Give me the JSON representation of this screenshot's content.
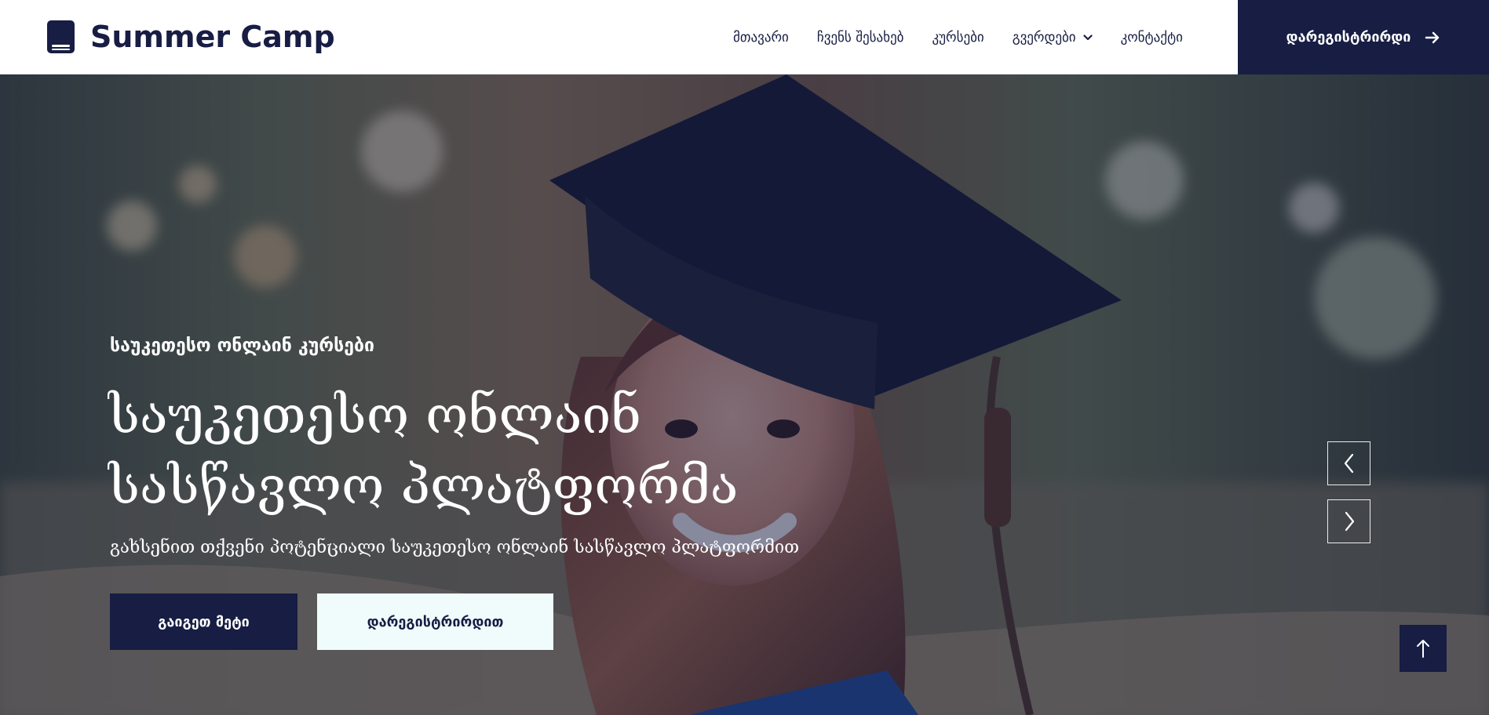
{
  "brand": {
    "title": "Summer Camp",
    "icon": "book-icon"
  },
  "nav": {
    "items": [
      {
        "label": "მთავარი"
      },
      {
        "label": "ჩვენს შესახებ"
      },
      {
        "label": "კურსები"
      },
      {
        "label": "გვერდები",
        "icon": "chevron-down-icon"
      },
      {
        "label": "კონტაქტი"
      }
    ],
    "register_label": "დარეგისტრირდი",
    "register_icon": "arrow-right-icon"
  },
  "hero": {
    "eyebrow": "საუკეთესო ონლაინ კურსები",
    "title_line_1": "საუკეთესო ონლაინ",
    "title_line_2": "სასწავლო პლატფორმა",
    "subtitle": "გახსენით თქვენი პოტენციალი საუკეთესო ონლაინ სასწავლო პლატფორმით",
    "primary_button": "გაიგეთ მეტი",
    "secondary_button": "დარეგისტრირდით"
  },
  "slider": {
    "previous_icon": "chevron-left-icon",
    "next_icon": "chevron-right-icon"
  },
  "back_to_top": {
    "icon": "arrow-up-icon"
  },
  "colors": {
    "navy": "#171d43",
    "white": "#ffffff",
    "light_button": "#f0fcfc",
    "overlay": "#181d43"
  }
}
